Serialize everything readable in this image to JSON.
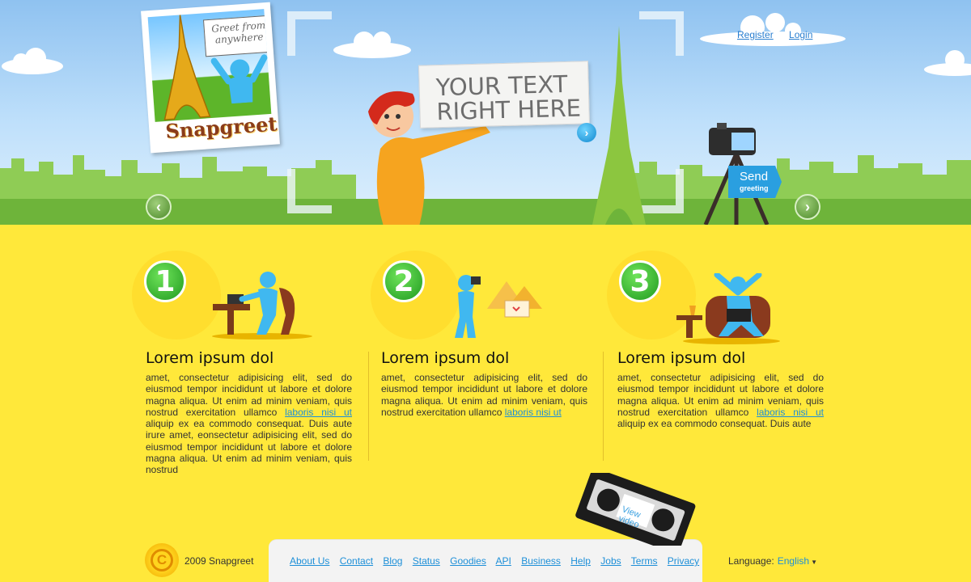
{
  "hero": {
    "logo": {
      "greet_text_1": "Greet from",
      "greet_text_2": "anywhere",
      "brand": "Snapgreet"
    },
    "auth": {
      "register": "Register",
      "login": "Login"
    },
    "speech": {
      "line1": "YOUR TEXT",
      "line2": "RIGHT HERE"
    },
    "send": {
      "line1": "Send",
      "line2": "greeting"
    },
    "prev_arrow": "‹",
    "next_arrow": "›",
    "go_arrow": "›"
  },
  "steps": [
    {
      "number": "1",
      "title": "Lorem ipsum dol",
      "body_before": "amet, consectetur adipisicing elit, sed do eiusmod tempor incididunt ut labore et dolore magna aliqua. Ut enim ad minim veniam, quis nostrud exercitation ullamco ",
      "link": "laboris nisi ut",
      "body_after": " aliquip ex ea commodo consequat. Duis aute irure amet, eonsectetur adipisicing elit, sed do eiusmod tempor incididunt ut labore et dolore magna aliqua. Ut enim ad minim veniam, quis nostrud"
    },
    {
      "number": "2",
      "title": "Lorem ipsum dol",
      "body_before": "amet, consectetur adipisicing elit, sed do eiusmod tempor incididunt ut labore et dolore magna aliqua. Ut enim ad minim veniam, quis nostrud exercitation ullamco ",
      "link": "laboris nisi ut",
      "body_after": ""
    },
    {
      "number": "3",
      "title": "Lorem ipsum dol",
      "body_before": "amet, consectetur adipisicing elit, sed do eiusmod tempor incididunt ut labore et dolore magna aliqua. Ut enim ad minim veniam, quis nostrud exercitation ullamco ",
      "link": "laboris nisi ut",
      "body_after": " aliquip ex ea commodo consequat. Duis aute"
    }
  ],
  "video": {
    "line1": "View",
    "line2": "video"
  },
  "footer": {
    "copyright_symbol": "C",
    "copyright": "2009 Snapgreet",
    "links": [
      "About Us",
      "Contact",
      "Blog",
      "Status",
      "Goodies",
      "API",
      "Business",
      "Help",
      "Jobs",
      "Terms",
      "Privacy"
    ],
    "language_label": "Language:",
    "language_value": "English"
  },
  "colors": {
    "sky": "#8fc2f0",
    "grass": "#7cc242",
    "ground": "#ffe83a",
    "link": "#1d8fd8",
    "badge_green": "#22a022"
  }
}
